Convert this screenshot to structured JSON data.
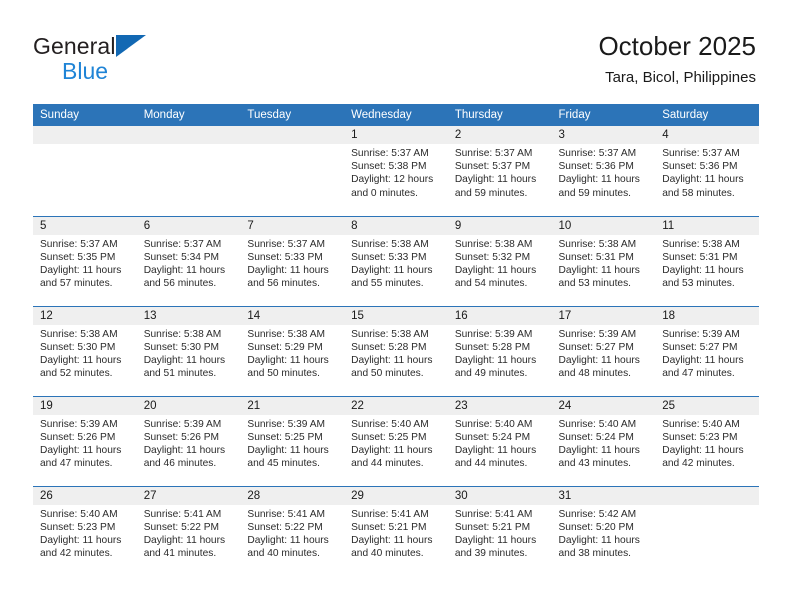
{
  "brand": {
    "name_part1": "General",
    "name_part2": "Blue",
    "triangle_icon": "triangle-icon",
    "accent_dark": "#231f20",
    "accent_blue": "#1f84d6",
    "triangle_color": "#1268b3"
  },
  "header": {
    "title": "October 2025",
    "subtitle": "Tara, Bicol, Philippines"
  },
  "theme": {
    "header_bg": "#2c74b8",
    "header_text": "#ffffff",
    "daynum_band_bg": "#efefef",
    "row_separator": "#2c74b8",
    "cell_bg": "#ffffff"
  },
  "weekdays": [
    "Sunday",
    "Monday",
    "Tuesday",
    "Wednesday",
    "Thursday",
    "Friday",
    "Saturday"
  ],
  "weeks": [
    [
      {
        "day": "",
        "sunrise": "",
        "sunset": "",
        "daylight_line1": "",
        "daylight_line2": ""
      },
      {
        "day": "",
        "sunrise": "",
        "sunset": "",
        "daylight_line1": "",
        "daylight_line2": ""
      },
      {
        "day": "",
        "sunrise": "",
        "sunset": "",
        "daylight_line1": "",
        "daylight_line2": ""
      },
      {
        "day": "1",
        "sunrise": "Sunrise: 5:37 AM",
        "sunset": "Sunset: 5:38 PM",
        "daylight_line1": "Daylight: 12 hours",
        "daylight_line2": "and 0 minutes."
      },
      {
        "day": "2",
        "sunrise": "Sunrise: 5:37 AM",
        "sunset": "Sunset: 5:37 PM",
        "daylight_line1": "Daylight: 11 hours",
        "daylight_line2": "and 59 minutes."
      },
      {
        "day": "3",
        "sunrise": "Sunrise: 5:37 AM",
        "sunset": "Sunset: 5:36 PM",
        "daylight_line1": "Daylight: 11 hours",
        "daylight_line2": "and 59 minutes."
      },
      {
        "day": "4",
        "sunrise": "Sunrise: 5:37 AM",
        "sunset": "Sunset: 5:36 PM",
        "daylight_line1": "Daylight: 11 hours",
        "daylight_line2": "and 58 minutes."
      }
    ],
    [
      {
        "day": "5",
        "sunrise": "Sunrise: 5:37 AM",
        "sunset": "Sunset: 5:35 PM",
        "daylight_line1": "Daylight: 11 hours",
        "daylight_line2": "and 57 minutes."
      },
      {
        "day": "6",
        "sunrise": "Sunrise: 5:37 AM",
        "sunset": "Sunset: 5:34 PM",
        "daylight_line1": "Daylight: 11 hours",
        "daylight_line2": "and 56 minutes."
      },
      {
        "day": "7",
        "sunrise": "Sunrise: 5:37 AM",
        "sunset": "Sunset: 5:33 PM",
        "daylight_line1": "Daylight: 11 hours",
        "daylight_line2": "and 56 minutes."
      },
      {
        "day": "8",
        "sunrise": "Sunrise: 5:38 AM",
        "sunset": "Sunset: 5:33 PM",
        "daylight_line1": "Daylight: 11 hours",
        "daylight_line2": "and 55 minutes."
      },
      {
        "day": "9",
        "sunrise": "Sunrise: 5:38 AM",
        "sunset": "Sunset: 5:32 PM",
        "daylight_line1": "Daylight: 11 hours",
        "daylight_line2": "and 54 minutes."
      },
      {
        "day": "10",
        "sunrise": "Sunrise: 5:38 AM",
        "sunset": "Sunset: 5:31 PM",
        "daylight_line1": "Daylight: 11 hours",
        "daylight_line2": "and 53 minutes."
      },
      {
        "day": "11",
        "sunrise": "Sunrise: 5:38 AM",
        "sunset": "Sunset: 5:31 PM",
        "daylight_line1": "Daylight: 11 hours",
        "daylight_line2": "and 53 minutes."
      }
    ],
    [
      {
        "day": "12",
        "sunrise": "Sunrise: 5:38 AM",
        "sunset": "Sunset: 5:30 PM",
        "daylight_line1": "Daylight: 11 hours",
        "daylight_line2": "and 52 minutes."
      },
      {
        "day": "13",
        "sunrise": "Sunrise: 5:38 AM",
        "sunset": "Sunset: 5:30 PM",
        "daylight_line1": "Daylight: 11 hours",
        "daylight_line2": "and 51 minutes."
      },
      {
        "day": "14",
        "sunrise": "Sunrise: 5:38 AM",
        "sunset": "Sunset: 5:29 PM",
        "daylight_line1": "Daylight: 11 hours",
        "daylight_line2": "and 50 minutes."
      },
      {
        "day": "15",
        "sunrise": "Sunrise: 5:38 AM",
        "sunset": "Sunset: 5:28 PM",
        "daylight_line1": "Daylight: 11 hours",
        "daylight_line2": "and 50 minutes."
      },
      {
        "day": "16",
        "sunrise": "Sunrise: 5:39 AM",
        "sunset": "Sunset: 5:28 PM",
        "daylight_line1": "Daylight: 11 hours",
        "daylight_line2": "and 49 minutes."
      },
      {
        "day": "17",
        "sunrise": "Sunrise: 5:39 AM",
        "sunset": "Sunset: 5:27 PM",
        "daylight_line1": "Daylight: 11 hours",
        "daylight_line2": "and 48 minutes."
      },
      {
        "day": "18",
        "sunrise": "Sunrise: 5:39 AM",
        "sunset": "Sunset: 5:27 PM",
        "daylight_line1": "Daylight: 11 hours",
        "daylight_line2": "and 47 minutes."
      }
    ],
    [
      {
        "day": "19",
        "sunrise": "Sunrise: 5:39 AM",
        "sunset": "Sunset: 5:26 PM",
        "daylight_line1": "Daylight: 11 hours",
        "daylight_line2": "and 47 minutes."
      },
      {
        "day": "20",
        "sunrise": "Sunrise: 5:39 AM",
        "sunset": "Sunset: 5:26 PM",
        "daylight_line1": "Daylight: 11 hours",
        "daylight_line2": "and 46 minutes."
      },
      {
        "day": "21",
        "sunrise": "Sunrise: 5:39 AM",
        "sunset": "Sunset: 5:25 PM",
        "daylight_line1": "Daylight: 11 hours",
        "daylight_line2": "and 45 minutes."
      },
      {
        "day": "22",
        "sunrise": "Sunrise: 5:40 AM",
        "sunset": "Sunset: 5:25 PM",
        "daylight_line1": "Daylight: 11 hours",
        "daylight_line2": "and 44 minutes."
      },
      {
        "day": "23",
        "sunrise": "Sunrise: 5:40 AM",
        "sunset": "Sunset: 5:24 PM",
        "daylight_line1": "Daylight: 11 hours",
        "daylight_line2": "and 44 minutes."
      },
      {
        "day": "24",
        "sunrise": "Sunrise: 5:40 AM",
        "sunset": "Sunset: 5:24 PM",
        "daylight_line1": "Daylight: 11 hours",
        "daylight_line2": "and 43 minutes."
      },
      {
        "day": "25",
        "sunrise": "Sunrise: 5:40 AM",
        "sunset": "Sunset: 5:23 PM",
        "daylight_line1": "Daylight: 11 hours",
        "daylight_line2": "and 42 minutes."
      }
    ],
    [
      {
        "day": "26",
        "sunrise": "Sunrise: 5:40 AM",
        "sunset": "Sunset: 5:23 PM",
        "daylight_line1": "Daylight: 11 hours",
        "daylight_line2": "and 42 minutes."
      },
      {
        "day": "27",
        "sunrise": "Sunrise: 5:41 AM",
        "sunset": "Sunset: 5:22 PM",
        "daylight_line1": "Daylight: 11 hours",
        "daylight_line2": "and 41 minutes."
      },
      {
        "day": "28",
        "sunrise": "Sunrise: 5:41 AM",
        "sunset": "Sunset: 5:22 PM",
        "daylight_line1": "Daylight: 11 hours",
        "daylight_line2": "and 40 minutes."
      },
      {
        "day": "29",
        "sunrise": "Sunrise: 5:41 AM",
        "sunset": "Sunset: 5:21 PM",
        "daylight_line1": "Daylight: 11 hours",
        "daylight_line2": "and 40 minutes."
      },
      {
        "day": "30",
        "sunrise": "Sunrise: 5:41 AM",
        "sunset": "Sunset: 5:21 PM",
        "daylight_line1": "Daylight: 11 hours",
        "daylight_line2": "and 39 minutes."
      },
      {
        "day": "31",
        "sunrise": "Sunrise: 5:42 AM",
        "sunset": "Sunset: 5:20 PM",
        "daylight_line1": "Daylight: 11 hours",
        "daylight_line2": "and 38 minutes."
      },
      {
        "day": "",
        "sunrise": "",
        "sunset": "",
        "daylight_line1": "",
        "daylight_line2": ""
      }
    ]
  ]
}
